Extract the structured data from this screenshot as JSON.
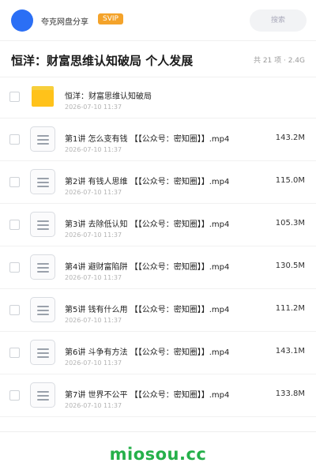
{
  "header": {
    "share_label": "夸克网盘分享",
    "badge": "SVIP",
    "search_placeholder": "搜索",
    "avatar_color": "#2b6ff5",
    "badge_color": "#f4a32a"
  },
  "title_bar": {
    "title": "恒洋：财富思维认知破局 个人发展",
    "meta": "共 21 项 · 2.4G"
  },
  "files": [
    {
      "type": "folder-icon",
      "name": "恒洋：财富思维认知破局",
      "date": "2026-07-10 11:37",
      "size": ""
    },
    {
      "type": "document-icon",
      "name": "第1讲 怎么变有钱 【【公众号：密知圈】】.mp4",
      "date": "2026-07-10 11:37",
      "size": "143.2M"
    },
    {
      "type": "document-icon",
      "name": "第2讲 有钱人思维 【【公众号：密知圈】】.mp4",
      "date": "2026-07-10 11:37",
      "size": "115.0M"
    },
    {
      "type": "document-icon",
      "name": "第3讲 去除低认知 【【公众号：密知圈】】.mp4",
      "date": "2026-07-10 11:37",
      "size": "105.3M"
    },
    {
      "type": "document-icon",
      "name": "第4讲 避财富陷阱 【【公众号：密知圈】】.mp4",
      "date": "2026-07-10 11:37",
      "size": "130.5M"
    },
    {
      "type": "document-icon",
      "name": "第5讲 钱有什么用 【【公众号：密知圈】】.mp4",
      "date": "2026-07-10 11:37",
      "size": "111.2M"
    },
    {
      "type": "document-icon",
      "name": "第6讲 斗争有方法 【【公众号：密知圈】】.mp4",
      "date": "2026-07-10 11:37",
      "size": "143.1M"
    },
    {
      "type": "document-icon",
      "name": "第7讲 世界不公平 【【公众号：密知圈】】.mp4",
      "date": "2026-07-10 11:37",
      "size": "133.8M"
    }
  ],
  "watermark": {
    "text": "miosou.cc",
    "color": "#25b04a"
  }
}
